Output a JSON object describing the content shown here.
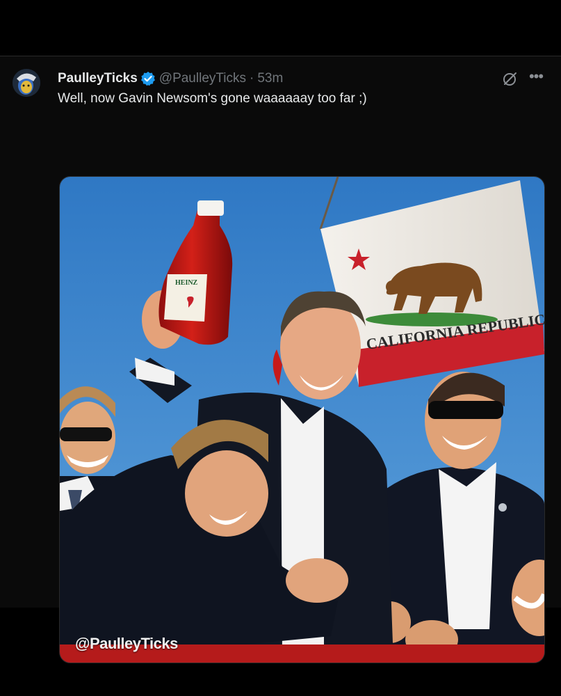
{
  "post": {
    "author_name": "PaulleyTicks",
    "author_handle": "@PaulleyTicks",
    "separator": "·",
    "timestamp": "53m",
    "verified": true,
    "text": "Well, now Gavin Newsom's gone waaaaaay too far ;)"
  },
  "media": {
    "flag_text": "CALIFORNIA REPUBLIC",
    "bottle_label": "HEINZ",
    "watermark": "@PaulleyTicks"
  },
  "icons": {
    "verified": "verified-badge-icon",
    "grok": "grok-icon",
    "more": "more-options-icon"
  },
  "colors": {
    "background": "#000000",
    "text_primary": "#e7e9ea",
    "text_secondary": "#71767b",
    "verified_blue": "#1d9bf0"
  }
}
